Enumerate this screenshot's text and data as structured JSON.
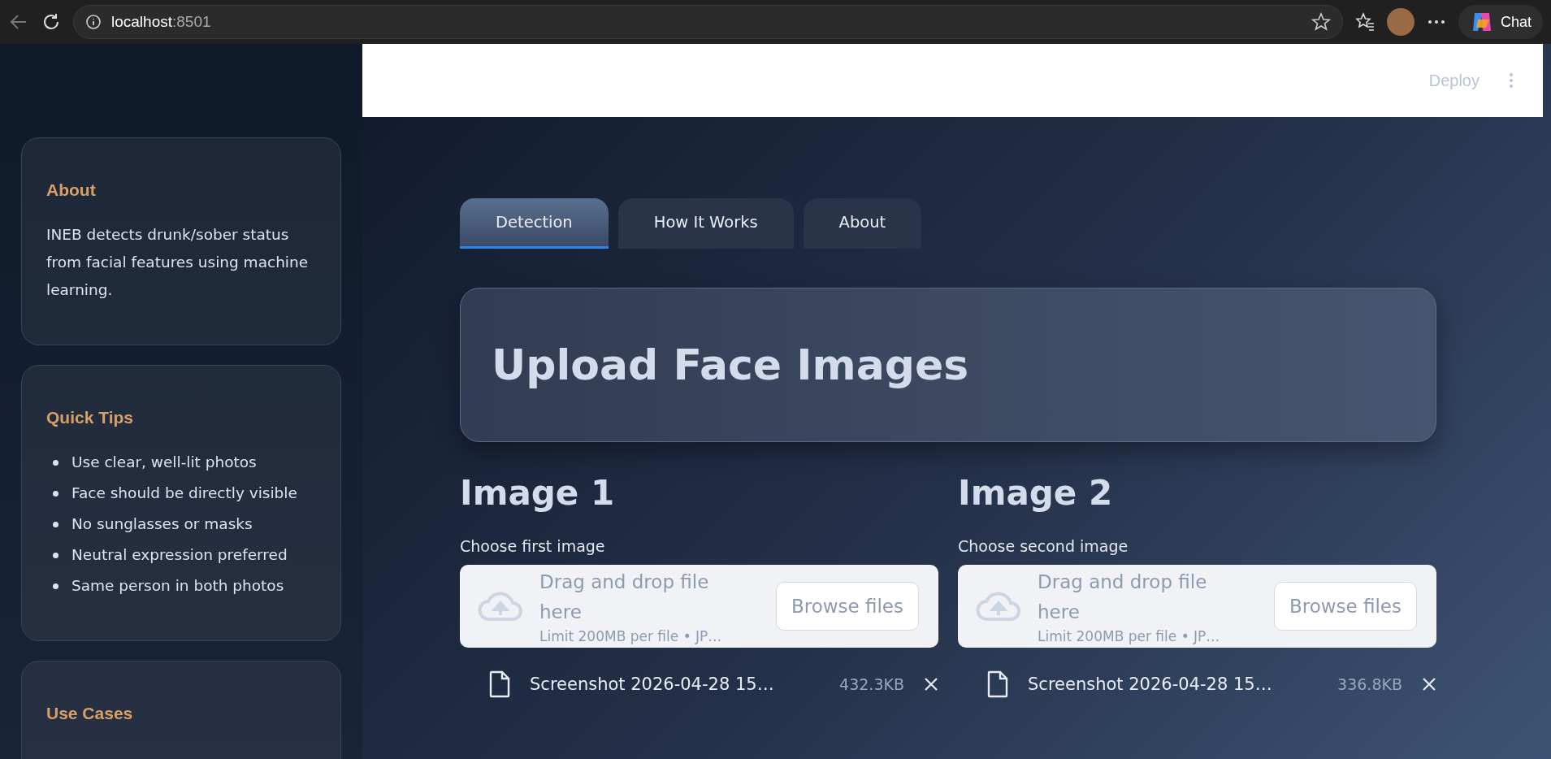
{
  "browser": {
    "host": "localhost",
    "port": ":8501",
    "chat": "Chat"
  },
  "sidebar": {
    "cards": [
      {
        "title": "About",
        "kind": "text",
        "text": "INEB detects drunk/sober status from facial features using machine learning."
      },
      {
        "title": "Quick Tips",
        "kind": "list",
        "items": [
          "Use clear, well-lit photos",
          "Face should be directly visible",
          "No sunglasses or masks",
          "Neutral expression preferred",
          "Same person in both photos"
        ]
      },
      {
        "title": "Use Cases",
        "kind": "text"
      }
    ]
  },
  "header": {
    "deploy": "Deploy"
  },
  "tabs": [
    {
      "label": "Detection",
      "selected": true
    },
    {
      "label": "How It Works",
      "selected": false
    },
    {
      "label": "About",
      "selected": false
    }
  ],
  "banner": {
    "title": "Upload Face Images"
  },
  "uploaders": [
    {
      "title": "Image 1",
      "label": "Choose first image",
      "drop_text": "Drag and drop file here",
      "limit_text": "Limit 200MB per file • JP…",
      "button": "Browse files",
      "file": {
        "name": "Screenshot 2026-04-28 15…",
        "size": "432.3KB"
      }
    },
    {
      "title": "Image 2",
      "label": "Choose second image",
      "drop_text": "Drag and drop file here",
      "limit_text": "Limit 200MB per file • JP…",
      "button": "Browse files",
      "file": {
        "name": "Screenshot 2026-04-28 15…",
        "size": "336.8KB"
      }
    }
  ]
}
